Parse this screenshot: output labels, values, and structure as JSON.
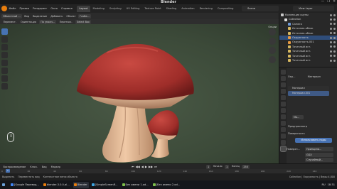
{
  "window": {
    "title": "Blender",
    "controls": [
      "—",
      "❐",
      "✕"
    ]
  },
  "menu": {
    "items": [
      "Файл",
      "Правка",
      "Рендеринг",
      "Окно",
      "Справка"
    ],
    "workspaces": [
      "Layout",
      "Modeling",
      "Sculpting",
      "UV Editing",
      "Texture Paint",
      "Shading",
      "Animation",
      "Rendering",
      "Compositing"
    ],
    "active_workspace": "Layout",
    "scene": "Scene",
    "view_layer": "View Layer"
  },
  "viewport_header": {
    "mode": "Объектный ...",
    "items": [
      "Вид",
      "Выделение",
      "Добавить",
      "Объект"
    ],
    "orientation": "Глоба...",
    "options": "Опции"
  },
  "viewport_header2": {
    "items": [
      "Перемест.",
      "Ориентация",
      "По умолч...",
      "Перетаск.",
      "Select Box"
    ]
  },
  "outliner": {
    "rows": [
      {
        "label": "Коллекция сцены",
        "indent": 0,
        "color": "#c8c8c8"
      },
      {
        "label": "Collection",
        "indent": 1,
        "color": "#e0e0e0"
      },
      {
        "label": "Camera",
        "indent": 2,
        "color": "#6f9ad8"
      },
      {
        "label": "Источник-облак",
        "indent": 2,
        "color": "#d8b860"
      },
      {
        "label": "Источник-облак",
        "indent": 2,
        "color": "#d8b860"
      },
      {
        "label": "Окружность",
        "indent": 2,
        "color": "#e89a40",
        "selected": true
      },
      {
        "label": "Окружность.001",
        "indent": 2,
        "color": "#e89a40"
      },
      {
        "label": "Точечный ист.",
        "indent": 2,
        "color": "#d8b860"
      },
      {
        "label": "Точечный ист.",
        "indent": 2,
        "color": "#d8b860"
      },
      {
        "label": "Точечный ист.",
        "indent": 2,
        "color": "#d8b860"
      },
      {
        "label": "Точечный ист.",
        "indent": 2,
        "color": "#d8b860"
      }
    ]
  },
  "properties": {
    "object_name": "Окр...",
    "material_tab": "Материал",
    "slots": [
      "Материал",
      "Материал.001"
    ],
    "material_name": "Ма...",
    "preview_label": "Предпросмотр",
    "surface_label": "Поверхность",
    "use_nodes_button": "Использовать ноды",
    "surface_field_label": "Поверхн...",
    "surface_field_value": "Принципи...",
    "distribution": "GGX",
    "subsurface": "Случайный...",
    "base_label": "Основн...",
    "base_color": "#f0a479"
  },
  "timeline": {
    "header": [
      "Воспроизведение",
      "Ключ.",
      "Вид",
      "Маркер"
    ],
    "controls": [
      "⏮",
      "◀◀",
      "◀",
      "▶",
      "▶▶",
      "⏭"
    ],
    "current_frame": "1",
    "start_label": "Начало",
    "start": "1",
    "end_label": "Конец",
    "end": "250",
    "ruler": [
      "0",
      "20",
      "40",
      "60",
      "80",
      "100",
      "120",
      "140",
      "160",
      "180",
      "200",
      "220",
      "240"
    ]
  },
  "statusbar": {
    "items": [
      "Выделить",
      "Переместить вид",
      "Контекстное меню объекта",
      "Collection | Окружность | Верш:4,800"
    ]
  },
  "taskbar": {
    "items": [
      {
        "label": "[Google Перевод...",
        "color": "#4285f4"
      },
      {
        "label": "blender-3.0.0-al...",
        "color": "#e87d0d"
      },
      {
        "label": "Blender",
        "color": "#e87d0d",
        "active": true
      },
      {
        "label": "[SimpleScreenR...",
        "color": "#3da4e0"
      },
      {
        "label": "Без имени 1.od...",
        "color": "#7ec04b"
      },
      {
        "label": "[Без имени 2.od...",
        "color": "#7ec04b"
      }
    ],
    "tray": [
      "RU",
      "18:31"
    ]
  }
}
